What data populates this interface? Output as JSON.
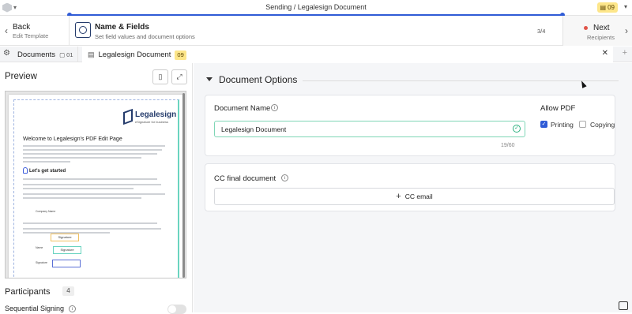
{
  "topbar": {
    "title": "Sending / Legalesign Document",
    "doc_count_badge": "09"
  },
  "stepbar": {
    "back": {
      "label": "Back",
      "sub": "Edit Template"
    },
    "step": {
      "title": "Name & Fields",
      "subtitle": "Set field values and document options",
      "counter": "3/4"
    },
    "next": {
      "label": "Next",
      "sub": "Recipients"
    }
  },
  "tabs": {
    "documents_label": "Documents",
    "documents_count": "01",
    "doc_tab_label": "Legalesign Document",
    "doc_tab_badge": "09"
  },
  "preview": {
    "title": "Preview",
    "page": {
      "brand_name": "Legalesign",
      "brand_tag": "eSignature for business",
      "heading": "Welcome to Legalesign's PDF Edit Page",
      "subheading": "Let's get started",
      "company_name_label": "Company Name",
      "field_signature_1": "Signature",
      "field_name_label": "Name",
      "field_signature_2": "Signature",
      "field_signature_label": "Signature",
      "field_signature_3": ""
    }
  },
  "participants": {
    "title": "Participants",
    "count": "4",
    "sequential_label": "Sequential Signing",
    "sequential_on": false
  },
  "options": {
    "section_title": "Document Options",
    "doc_name_label": "Document Name",
    "doc_name_value": "Legalesign Document",
    "char_count": "19/60",
    "allow_pdf_label": "Allow PDF",
    "printing_label": "Printing",
    "printing_checked": true,
    "copying_label": "Copying",
    "copying_checked": false,
    "cc_label": "CC final document",
    "cc_button": "CC email"
  },
  "colors": {
    "accent": "#2f5bd6",
    "badge": "#fde68a",
    "success": "#2bb07f",
    "brand": "#243b6b"
  }
}
